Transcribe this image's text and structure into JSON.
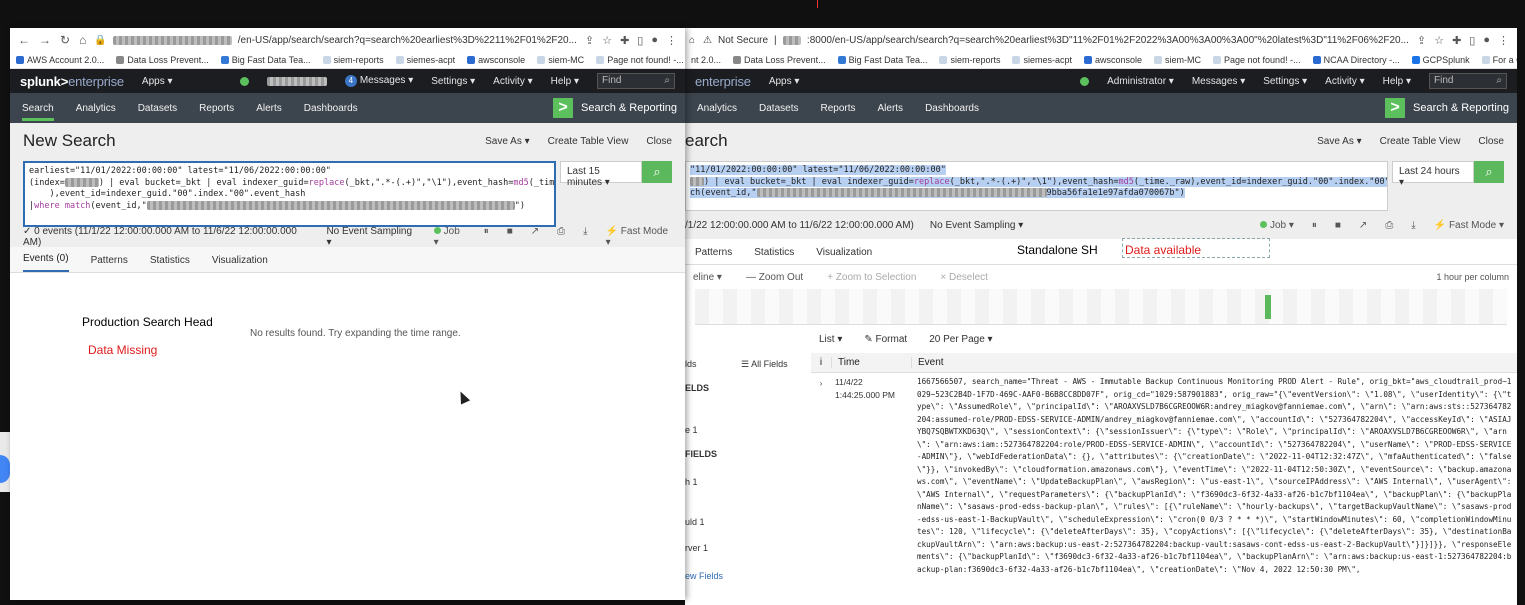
{
  "left": {
    "url_suffix": "/en-US/app/search/search?q=search%20earliest%3D%2211%2F01%2F20...",
    "bookmarks": [
      "AWS Account 2.0...",
      "Data Loss Prevent...",
      "Big Fast Data Tea...",
      "siem-reports",
      "siemes-acpt",
      "awsconsole",
      "siem-MC",
      "Page not found! -..."
    ],
    "logo_main": "splunk>",
    "logo_sub": "enterprise",
    "apps": "Apps ▾",
    "messages_count": "4",
    "messages": "Messages ▾",
    "settings": "Settings ▾",
    "activity": "Activity ▾",
    "help": "Help ▾",
    "find": "Find",
    "nav": [
      "Search",
      "Analytics",
      "Datasets",
      "Reports",
      "Alerts",
      "Dashboards"
    ],
    "app_name": "Search & Reporting",
    "title": "New Search",
    "save_as": "Save As ▾",
    "create_table": "Create Table View",
    "close": "Close",
    "query_l1": "earliest=\"11/01/2022:00:00:00\" latest=\"11/06/2022:00:00:00\"",
    "query_l2a": "(index=",
    "query_l2b": ") | eval bucket=_bkt | eval indexer_guid=",
    "query_l2c": "replace",
    "query_l2d": "(_bkt,\".*-(.+)\",\"\\1\"),event_hash=",
    "query_l2e": "md5",
    "query_l2f": "(_time._raw",
    "query_l3": "    ),event_id=indexer_guid.\"00\".index.\"00\".event_hash",
    "query_l4a": "|",
    "query_l4b": "where match",
    "query_l4c": "(event_id,\"",
    "query_l4d": "\")",
    "timepicker": "Last 15 minutes ▾",
    "events_status": "✓ 0 events (11/1/22 12:00:00.000 AM to 11/6/22 12:00:00.000 AM)",
    "sampling": "No Event Sampling ▾",
    "job": "Job ▾",
    "mode": "⚡ Fast Mode ▾",
    "tabs": [
      "Events (0)",
      "Patterns",
      "Statistics",
      "Visualization"
    ],
    "no_results": "No results found. Try expanding the time range.",
    "annotation": "Production Search Head",
    "annotation_red": "Data Missing"
  },
  "right": {
    "not_secure": "Not Secure",
    "url_suffix": ":8000/en-US/app/search/search?q=search%20earliest%3D\"11%2F01%2F2022%3A00%3A00%3A00\"%20latest%3D\"11%2F06%2F20...",
    "bookmarks": [
      "nt 2.0...",
      "Data Loss Prevent...",
      "Big Fast Data Tea...",
      "siem-reports",
      "siemes-acpt",
      "awsconsole",
      "siem-MC",
      "Page not found! -...",
      "NCAA Directory -...",
      "GCPSplunk",
      "For a Good Strftim..."
    ],
    "logo_sub": "enterprise",
    "apps": "Apps ▾",
    "admin": "Administrator ▾",
    "messages": "Messages ▾",
    "settings": "Settings ▾",
    "activity": "Activity ▾",
    "help": "Help ▾",
    "find": "Find",
    "nav": [
      "Analytics",
      "Datasets",
      "Reports",
      "Alerts",
      "Dashboards"
    ],
    "app_name": "Search & Reporting",
    "title": "earch",
    "save_as": "Save As ▾",
    "create_table": "Create Table View",
    "close": "Close",
    "query_l1": "\"11/01/2022:00:00:00\" latest=\"11/06/2022:00:00:00\"",
    "query_l2a": ") | eval bucket=_bkt | eval indexer_guid=",
    "query_l2b": "replace",
    "query_l2c": "(_bkt,\".*-(.+)\",\"\\1\"),event_hash=",
    "query_l2d": "md5",
    "query_l2e": "(_time._raw),event_id=indexer_guid.\"00\".index.\"00\".event_hash",
    "query_l3a": "ch(event_id,\"",
    "query_l3b": "9bba56fa1e1e97afda070067b\")",
    "timepicker": "Last 24 hours ▾",
    "events_status": "/1/22 12:00:00.000 AM to 11/6/22 12:00:00.000 AM)",
    "sampling": "No Event Sampling ▾",
    "job": "Job ▾",
    "mode": "⚡ Fast Mode ▾",
    "tabs": [
      "Patterns",
      "Statistics",
      "Visualization"
    ],
    "annotation": "Standalone SH",
    "annotation_red": "Data available",
    "timeline": "eline ▾",
    "zoom_out": "— Zoom Out",
    "zoom_sel": "+ Zoom to Selection",
    "deselect": "× Deselect",
    "per_column": "1 hour per column",
    "list": "List ▾",
    "format": "✎ Format",
    "per_page": "20 Per Page ▾",
    "all_fields": "☰ All Fields",
    "sidebar_items": [
      "lds",
      "ELDS",
      "e 1",
      "FIELDS",
      "h 1",
      "uld 1",
      "rver 1",
      "ew Fields"
    ],
    "col_i": "i",
    "col_time": "Time",
    "col_event": "Event",
    "row_date": "11/4/22",
    "row_time": "1:44:25.000 PM",
    "event_text": "1667566507, search_name=\"Threat - AWS - Immutable Backup Continuous Monitoring PROD Alert - Rule\", orig_bkt=\"aws_cloudtrail_prod~1029~523C2B4D-1F7D-469C-AAF0-B6B8CC8DD07F\", orig_cd=\"1029:587901883\", orig_raw=\"{\\\"eventVersion\\\": \\\"1.08\\\", \\\"userIdentity\\\": {\\\"type\\\": \\\"AssumedRole\\\", \\\"principalId\\\": \\\"AROAXVSLD7B6CGREOOW6R:andrey_miagkov@fanniemae.com\\\", \\\"arn\\\": \\\"arn:aws:sts::527364782204:assumed-role/PROD-EDSS-SERVICE-ADMIN/andrey_miagkov@fanniemae.com\\\", \\\"accountId\\\": \\\"527364782204\\\", \\\"accessKeyId\\\": \\\"ASIAJYBQ7SQBWTXKD63Q\\\", \\\"sessionContext\\\": {\\\"sessionIssuer\\\": {\\\"type\\\": \\\"Role\\\", \\\"principalId\\\": \\\"AROAXVSLD7B6CGREOOW6R\\\", \\\"arn\\\": \\\"arn:aws:iam::527364782204:role/PROD-EDSS-SERVICE-ADMIN\\\", \\\"accountId\\\": \\\"527364782204\\\", \\\"userName\\\": \\\"PROD-EDSS-SERVICE-ADMIN\\\"}, \\\"webIdFederationData\\\": {}, \\\"attributes\\\": {\\\"creationDate\\\": \\\"2022-11-04T12:32:47Z\\\", \\\"mfaAuthenticated\\\": \\\"false\\\"}}, \\\"invokedBy\\\": \\\"cloudformation.amazonaws.com\\\"}, \\\"eventTime\\\": \\\"2022-11-04T12:50:30Z\\\", \\\"eventSource\\\": \\\"backup.amazonaws.com\\\", \\\"eventName\\\": \\\"UpdateBackupPlan\\\", \\\"awsRegion\\\": \\\"us-east-1\\\", \\\"sourceIPAddress\\\": \\\"AWS Internal\\\", \\\"userAgent\\\": \\\"AWS Internal\\\", \\\"requestParameters\\\": {\\\"backupPlanId\\\": \\\"f3690dc3-6f32-4a33-af26-b1c7bf1104ea\\\", \\\"backupPlan\\\": {\\\"backupPlanName\\\": \\\"sasaws-prod-edss-backup-plan\\\", \\\"rules\\\": [{\\\"ruleName\\\": \\\"hourly-backups\\\", \\\"targetBackupVaultName\\\": \\\"sasaws-prod-edss-us-east-1-BackupVault\\\", \\\"scheduleExpression\\\": \\\"cron(0 0/3 ? * * *)\\\", \\\"startWindowMinutes\\\": 60, \\\"completionWindowMinutes\\\": 120, \\\"lifecycle\\\": {\\\"deleteAfterDays\\\": 35}, \\\"copyActions\\\": [{\\\"lifecycle\\\": {\\\"deleteAfterDays\\\": 35}, \\\"destinationBackupVaultArn\\\": \\\"arn:aws:backup:us-east-2:527364782204:backup-vault:sasaws-cont-edss-us-east-2-BackupVault\\\"}]}]}}, \\\"responseElements\\\": {\\\"backupPlanId\\\": \\\"f3690dc3-6f32-4a33-af26-b1c7bf1104ea\\\", \\\"backupPlanArn\\\": \\\"arn:aws:backup:us-east-1:527364782204:backup-plan:f3690dc3-6f32-4a33-af26-b1c7bf1104ea\\\", \\\"creationDate\\\": \\\"Nov 4, 2022 12:50:30 PM\\\","
  }
}
